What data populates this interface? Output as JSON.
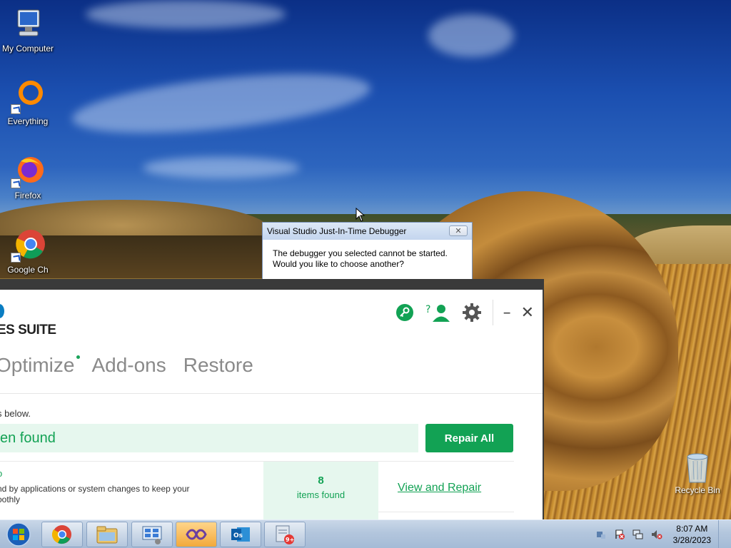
{
  "desktop": {
    "icons": [
      {
        "label": "My Computer",
        "icon": "computer-icon"
      },
      {
        "label": "Everything",
        "icon": "everything-search-icon"
      },
      {
        "label": "Firefox",
        "icon": "firefox-icon"
      },
      {
        "label": "Google Ch",
        "icon": "chrome-icon"
      }
    ],
    "recycle_bin": {
      "label": "Recycle Bin",
      "icon": "recycle-bin-icon"
    }
  },
  "jit_dialog": {
    "title": "Visual Studio Just-In-Time Debugger",
    "close_glyph": "✕",
    "message_line1": "The debugger you selected cannot be started.",
    "message_line2": "Would you like to choose another?"
  },
  "app": {
    "logo_text": "ES SUITE",
    "header_icons": [
      "key-icon",
      "help-user-icon",
      "gear-icon"
    ],
    "minimize_glyph": "–",
    "close_glyph": "✕",
    "nav": [
      {
        "label": "Optimize"
      },
      {
        "label": "Add-ons"
      },
      {
        "label": "Restore"
      }
    ],
    "subtitle": "s below.",
    "found_text": "en found",
    "repair_all_label": "Repair All",
    "row": {
      "title": "o",
      "desc_line1": "nd by applications or system changes to keep your",
      "desc_line2": "oothly",
      "count": "8",
      "count_label": "items found",
      "action_label": "View and Repair"
    },
    "colors": {
      "accent": "#12a254",
      "accent_light": "#e6f7ee"
    }
  },
  "taskbar": {
    "apps": [
      "chrome-icon",
      "file-explorer-icon",
      "control-panel-icon",
      "visual-studio-icon",
      "outlook-icon",
      "utility-app-icon"
    ],
    "badge": "9+",
    "tray_icons": [
      "network-config-icon",
      "action-center-icon",
      "network-icon",
      "volume-muted-icon"
    ],
    "time": "8:07 AM",
    "date": "3/28/2023"
  }
}
